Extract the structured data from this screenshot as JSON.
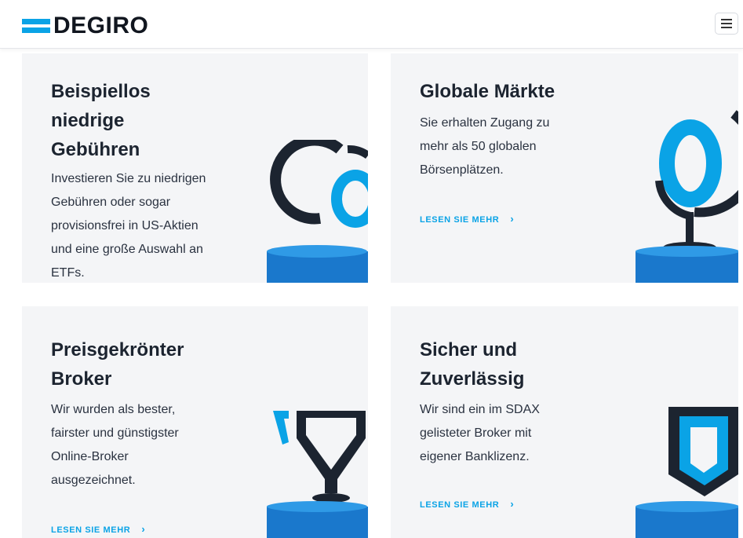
{
  "header": {
    "logo_text": "DEGIRO",
    "menu_icon": "hamburger-icon"
  },
  "cards": [
    {
      "title": [
        "Beispiellos",
        "niedrige",
        "Gebühren"
      ],
      "description": [
        "Investieren Sie zu niedrigen",
        "Gebühren oder sogar",
        "provisionsfrei in US-Aktien",
        "und eine große Auswahl an",
        "ETFs."
      ],
      "link": "",
      "icon": "coins-illustration-icon"
    },
    {
      "title": [
        "Globale Märkte"
      ],
      "description": [
        "Sie erhalten Zugang zu",
        "mehr als 50 globalen",
        "Börsenplätzen."
      ],
      "link": "LESEN SIE MEHR",
      "icon": "globe-illustration-icon"
    },
    {
      "title": [
        "Preisgekrönter",
        "Broker"
      ],
      "description": [
        "Wir wurden als bester,",
        "fairster und günstigster",
        "Online-Broker",
        "ausgezeichnet."
      ],
      "link": "LESEN SIE MEHR",
      "icon": "trophy-illustration-icon"
    },
    {
      "title": [
        "Sicher und",
        "Zuverlässig"
      ],
      "description": [
        "Wir sind ein im SDAX",
        "gelisteter Broker mit",
        "eigener Banklizenz."
      ],
      "link": "LESEN SIE MEHR",
      "icon": "shield-illustration-icon"
    }
  ],
  "link_chevron": "›",
  "colors": {
    "accent": "#0aa3e6",
    "dark": "#1c2430",
    "card_bg": "#f4f5f7"
  }
}
